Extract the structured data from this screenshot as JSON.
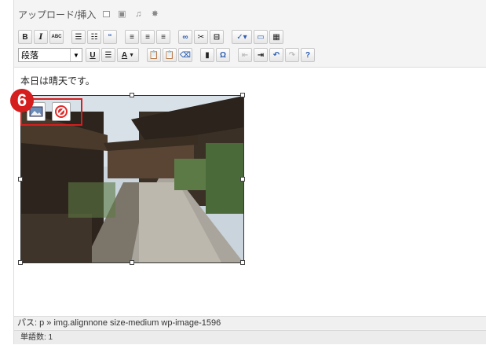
{
  "upload": {
    "label": "アップロード/挿入",
    "icons": [
      "image-icon",
      "video-icon",
      "music-icon",
      "media-icon"
    ]
  },
  "toolbar1": {
    "bold": "B",
    "italic": "I",
    "strike": "ABC",
    "quote": "“"
  },
  "toolbar2": {
    "format_value": "段落",
    "underline": "U",
    "text_color": "A"
  },
  "editor": {
    "paragraph": "本日は晴天です。"
  },
  "annotation": {
    "step_number": "6"
  },
  "status": {
    "path": "パス: p » img.alignnone size-medium wp-image-1596",
    "word_count": "単語数: 1"
  },
  "colors": {
    "badge_red": "#d51e1e",
    "toolbar_blue": "#2a5db0"
  }
}
